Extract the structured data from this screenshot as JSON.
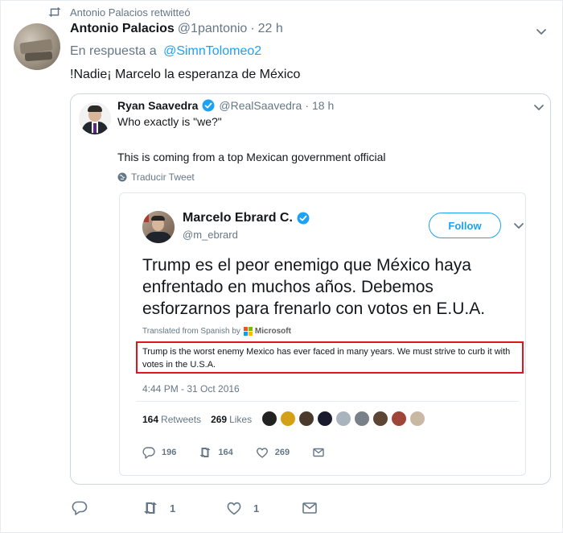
{
  "retweet": {
    "text": "Antonio Palacios retwitteó"
  },
  "tweet": {
    "author_name": "Antonio Palacios",
    "author_handle": "@1pantonio",
    "separator": "·",
    "time": "22 h",
    "reply_prefix": "En respuesta a",
    "reply_to": "@SimnTolomeo2",
    "text": "!Nadie¡ Marcelo la esperanza de México",
    "actions": {
      "retweets": "1",
      "likes": "1"
    }
  },
  "quoted": {
    "author_name": "Ryan Saavedra",
    "author_handle": "@RealSaavedra",
    "separator": "·",
    "time": "18 h",
    "line1": "Who exactly is \"we?\"",
    "line2": "This is coming from a top Mexican government official",
    "translate_label": "Traducir Tweet"
  },
  "embedded": {
    "author_name": "Marcelo Ebrard C.",
    "author_handle": "@m_ebrard",
    "follow_label": "Follow",
    "text": "Trump es el peor enemigo que México haya enfrentado en muchos años. Debemos esforzarnos para frenarlo con votos en E.U.A.",
    "translated_from": "Translated from Spanish by",
    "translator": "Microsoft",
    "translation": "Trump is the worst enemy Mexico has ever faced in many years. We must strive to curb it with votes in the U.S.A.",
    "date": "4:44 PM - 31 Oct 2016",
    "retweets_count": "164",
    "retweets_label": "Retweets",
    "likes_count": "269",
    "likes_label": "Likes",
    "reply_count": "196",
    "retweet_count": "164",
    "like_count": "269"
  },
  "colors": {
    "accent": "#1da1f2",
    "muted": "#657786",
    "highlight": "#e0141e",
    "verified": "#1da1f2"
  }
}
